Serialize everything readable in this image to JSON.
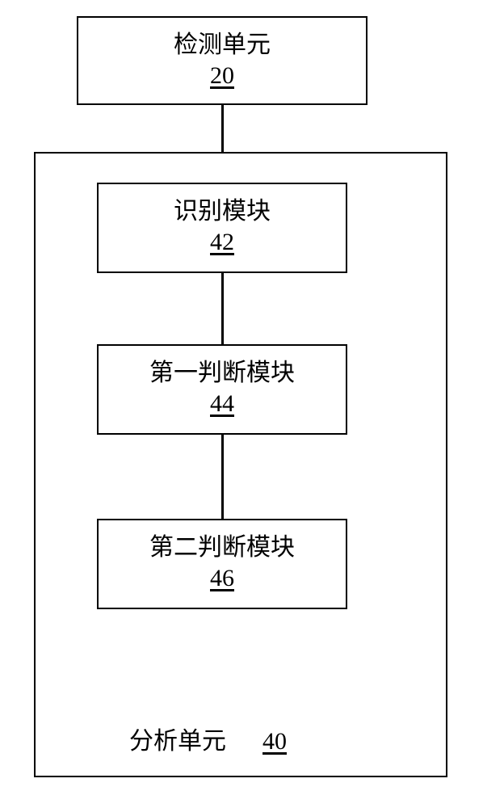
{
  "chart_data": {
    "type": "diagram",
    "nodes": [
      {
        "id": "20",
        "label": "检测单元",
        "number": "20"
      },
      {
        "id": "40",
        "label": "分析单元",
        "number": "40",
        "children": [
          {
            "id": "42",
            "label": "识别模块",
            "number": "42"
          },
          {
            "id": "44",
            "label": "第一判断模块",
            "number": "44"
          },
          {
            "id": "46",
            "label": "第二判断模块",
            "number": "46"
          }
        ]
      }
    ],
    "edges": [
      {
        "from": "20",
        "to": "42"
      },
      {
        "from": "42",
        "to": "44"
      },
      {
        "from": "44",
        "to": "46"
      }
    ]
  },
  "boxes": {
    "b20": {
      "label": "检测单元",
      "number": "20"
    },
    "b42": {
      "label": "识别模块",
      "number": "42"
    },
    "b44": {
      "label": "第一判断模块",
      "number": "44"
    },
    "b46": {
      "label": "第二判断模块",
      "number": "46"
    },
    "b40": {
      "label": "分析单元",
      "number": "40"
    }
  }
}
